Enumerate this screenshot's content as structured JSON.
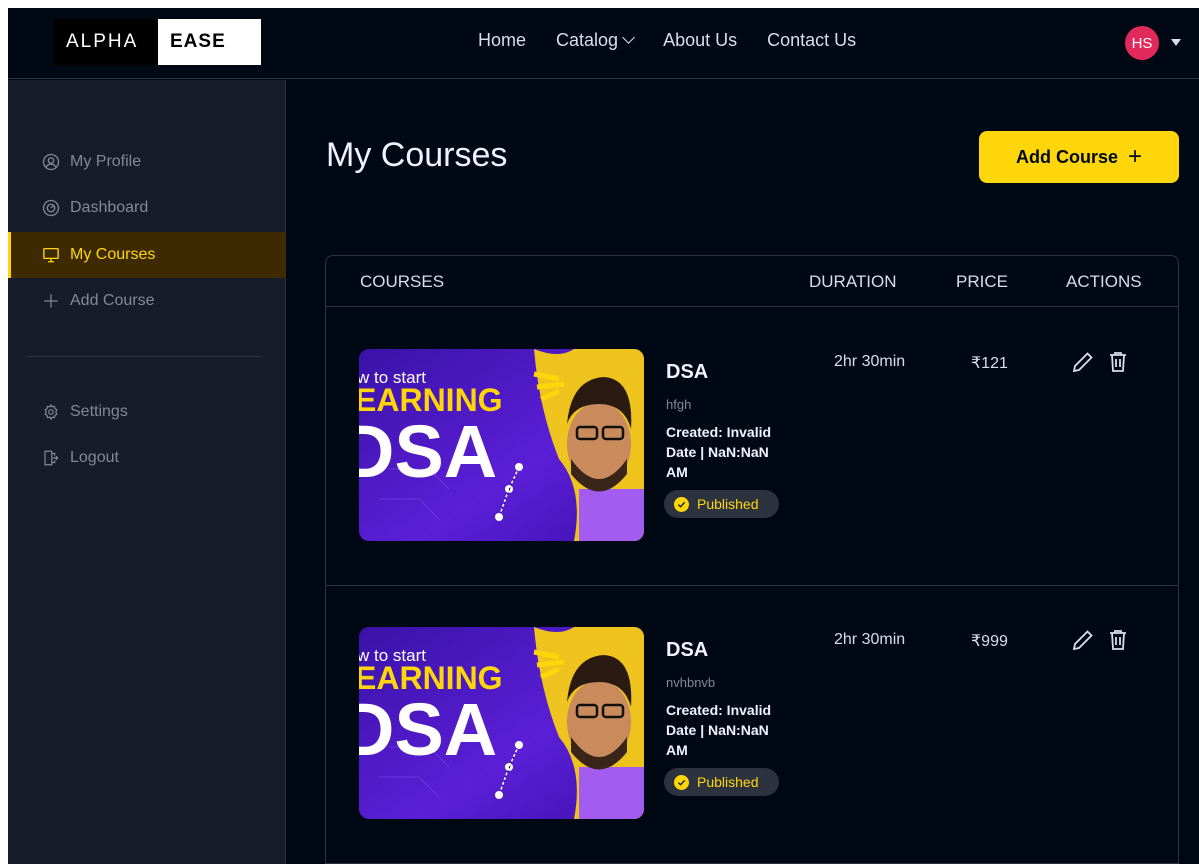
{
  "logo": {
    "left": "ALPHA",
    "right": "EASE"
  },
  "nav": {
    "links": [
      "Home",
      "Catalog",
      "About Us",
      "Contact Us"
    ],
    "avatar_initials": "HS"
  },
  "sidebar": {
    "items": [
      {
        "label": "My Profile",
        "icon": "user-circle-icon"
      },
      {
        "label": "Dashboard",
        "icon": "gauge-icon"
      },
      {
        "label": "My Courses",
        "icon": "monitor-icon",
        "active": true
      },
      {
        "label": "Add Course",
        "icon": "plus-icon"
      }
    ],
    "settings_label": "Settings",
    "logout_label": "Logout"
  },
  "main": {
    "title": "My Courses",
    "add_button_label": "Add Course"
  },
  "table": {
    "headers": {
      "courses": "COURSES",
      "duration": "DURATION",
      "price": "PRICE",
      "actions": "ACTIONS"
    },
    "rows": [
      {
        "name": "DSA",
        "description": "hfgh",
        "created": "Created: Invalid Date | NaN:NaN AM",
        "status": "Published",
        "duration": "2hr 30min",
        "price": "₹121",
        "thumbnail_text": [
          "w to start",
          "EARNING",
          "DSA"
        ]
      },
      {
        "name": "DSA",
        "description": "nvhbnvb",
        "created": "Created: Invalid Date | NaN:NaN AM",
        "status": "Published",
        "duration": "2hr 30min",
        "price": "₹999",
        "thumbnail_text": [
          "w to start",
          "EARNING",
          "DSA"
        ]
      }
    ]
  },
  "colors": {
    "background": "#000814",
    "sidebar": "#161d29",
    "accent": "#ffd60a",
    "avatar": "#e2295b",
    "thumbnail_purple": "#5b1fd6"
  }
}
